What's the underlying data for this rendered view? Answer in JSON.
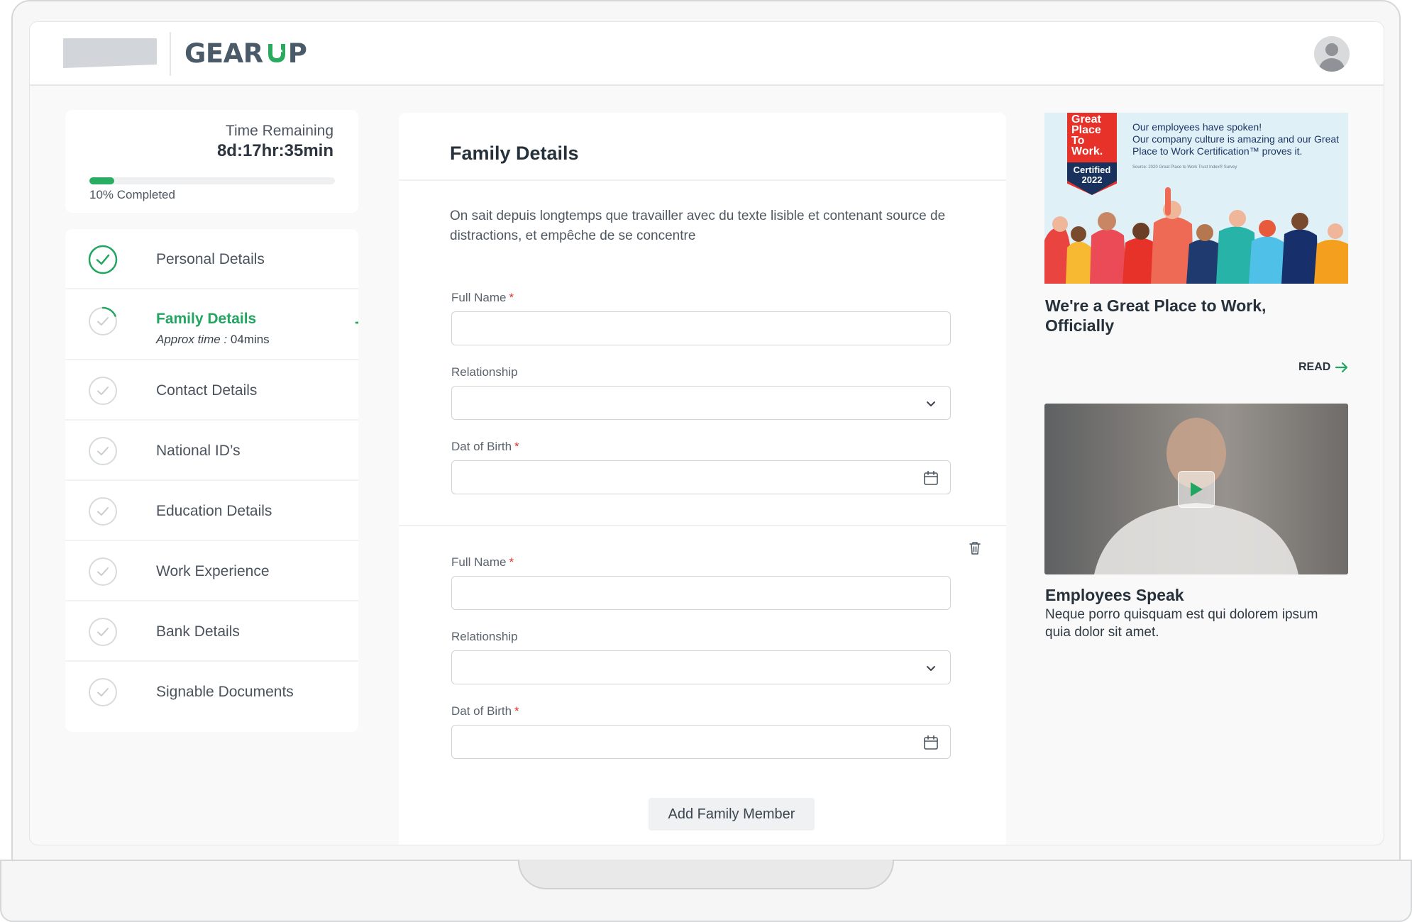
{
  "brand": {
    "name_left": "GEAR",
    "name_right": "P"
  },
  "timer": {
    "label": "Time Remaining",
    "value": "8d:17hr:35min",
    "progress_fraction": 0.1,
    "progress_text": "10% Completed"
  },
  "steps": [
    {
      "label": "Personal Details",
      "status": "completed"
    },
    {
      "label": "Family Details",
      "status": "active",
      "sub_prefix": "Approx time : ",
      "sub_value": "04mins"
    },
    {
      "label": "Contact Details",
      "status": "pending"
    },
    {
      "label": "National ID’s",
      "status": "pending"
    },
    {
      "label": "Education Details",
      "status": "pending"
    },
    {
      "label": "Work Experience",
      "status": "pending"
    },
    {
      "label": "Bank Details",
      "status": "pending"
    },
    {
      "label": "Signable Documents",
      "status": "pending"
    }
  ],
  "form": {
    "title": "Family Details",
    "description": "On sait depuis longtemps que travailler avec du texte lisible et contenant source de distractions, et empêche de se concentre",
    "members": [
      {
        "full_name_label": "Full Name",
        "full_name_value": "",
        "relationship_label": "Relationship",
        "relationship_value": "",
        "dob_label": "Dat of Birth",
        "dob_value": ""
      },
      {
        "full_name_label": "Full Name",
        "full_name_value": "",
        "relationship_label": "Relationship",
        "relationship_value": "",
        "dob_label": "Dat of Birth",
        "dob_value": ""
      }
    ],
    "required_mark": "*",
    "add_button": "Add Family Member"
  },
  "promo": {
    "badge_line1": "Great",
    "badge_line2": "Place",
    "badge_line3": "To",
    "badge_line4": "Work.",
    "badge_certified": "Certified",
    "badge_year": "2022",
    "text_line1": "Our employees have spoken!",
    "text_line2": "Our company culture is amazing and our Great Place to Work Certification™ proves it.",
    "source": "Source: 2020 Great Place to Work Trust Index® Survey",
    "title": "We're a Great Place to Work, Officially",
    "read_label": "READ"
  },
  "video": {
    "title": "Employees Speak",
    "description": "Neque porro quisquam est qui dolorem ipsum quia dolor sit amet."
  },
  "colors": {
    "accent_green": "#22a560",
    "progress_green": "#29ad63",
    "required_red": "#e0342f",
    "brand_navy": "#4a5a68"
  }
}
